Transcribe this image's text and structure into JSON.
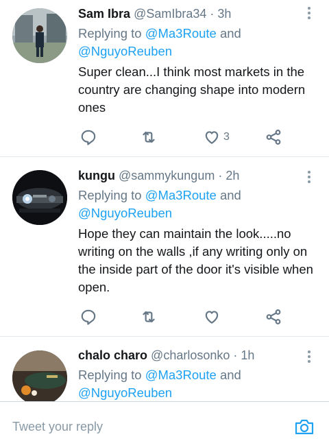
{
  "tweets": [
    {
      "name": "Sam Ibra",
      "handle": "@SamIbra34",
      "time": "· 3h",
      "replying_prefix": "Replying to ",
      "replying_user1": "@Ma3Route",
      "replying_and": " and",
      "replying_user2": "@NguyoReuben",
      "text": "Super clean...I think most markets in the country are changing shape into modern ones",
      "like_count": "3"
    },
    {
      "name": "kungu",
      "handle": "@sammykungum",
      "time": "· 2h",
      "replying_prefix": "Replying to ",
      "replying_user1": "@Ma3Route",
      "replying_and": " and",
      "replying_user2": "@NguyoReuben",
      "text": "Hope they can maintain the look.....no writing on the walls ,if any writing only on the inside part of the door it's visible when open.",
      "like_count": ""
    },
    {
      "name": "chalo charo",
      "handle": "@charlosonko",
      "time": "· 1h",
      "replying_prefix": "Replying to ",
      "replying_user1": "@Ma3Route",
      "replying_and": " and",
      "replying_user2": "@NguyoReuben"
    }
  ],
  "composer": {
    "placeholder": "Tweet your reply"
  },
  "icons": {
    "reply": "reply-icon",
    "retweet": "retweet-icon",
    "like": "like-icon",
    "share": "share-icon",
    "more": "more-options-icon",
    "camera": "camera-icon"
  },
  "colors": {
    "link": "#1da1f2",
    "muted": "#657786",
    "text": "#14171a"
  }
}
